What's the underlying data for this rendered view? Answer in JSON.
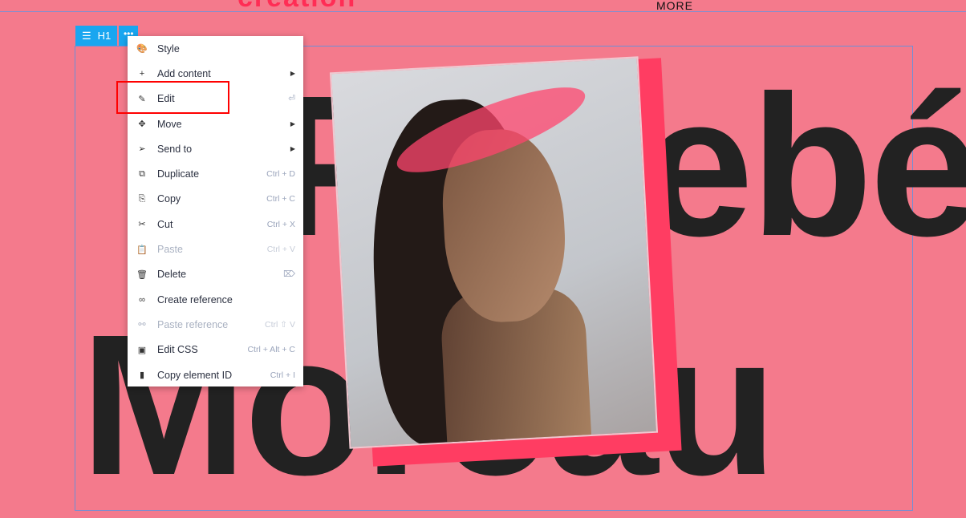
{
  "page": {
    "brand": "creation",
    "more": "MORE",
    "heading_line1": "Phoebé",
    "heading_line2": "Moreau",
    "bg_color": "#f47a8c"
  },
  "toolbar": {
    "tag": "H1",
    "icon": "heading-icon",
    "more_icon": "more-icon",
    "color": "#19a6f0"
  },
  "menu": {
    "items": [
      {
        "label": "Style",
        "icon": "palette-icon",
        "ic": "🎨",
        "shortcut": "",
        "submenu": false,
        "disabled": false
      },
      {
        "label": "Add content",
        "icon": "plus-icon",
        "ic": "+",
        "shortcut": "",
        "submenu": true,
        "disabled": false
      },
      {
        "label": "Edit",
        "icon": "pencil-icon",
        "ic": "✎",
        "shortcut": "⏎",
        "submenu": false,
        "disabled": false
      },
      {
        "label": "Move",
        "icon": "move-icon",
        "ic": "✥",
        "shortcut": "",
        "submenu": true,
        "disabled": false
      },
      {
        "label": "Send to",
        "icon": "send-icon",
        "ic": "➢",
        "shortcut": "",
        "submenu": true,
        "disabled": false
      },
      {
        "label": "Duplicate",
        "icon": "duplicate-icon",
        "ic": "⧉",
        "shortcut": "Ctrl + D",
        "submenu": false,
        "disabled": false
      },
      {
        "label": "Copy",
        "icon": "copy-icon",
        "ic": "⎘",
        "shortcut": "Ctrl + C",
        "submenu": false,
        "disabled": false
      },
      {
        "label": "Cut",
        "icon": "scissors-icon",
        "ic": "✂",
        "shortcut": "Ctrl + X",
        "submenu": false,
        "disabled": false
      },
      {
        "label": "Paste",
        "icon": "paste-icon",
        "ic": "📋",
        "shortcut": "Ctrl + V",
        "submenu": false,
        "disabled": true
      },
      {
        "label": "Delete",
        "icon": "trash-icon",
        "ic": "🗑",
        "shortcut": "⌦",
        "submenu": false,
        "disabled": false
      },
      {
        "label": "Create reference",
        "icon": "link-icon",
        "ic": "∞",
        "shortcut": "",
        "submenu": false,
        "disabled": false
      },
      {
        "label": "Paste reference",
        "icon": "paste-reference-icon",
        "ic": "⚯",
        "shortcut": "Ctrl ⇧ V",
        "submenu": false,
        "disabled": true
      },
      {
        "label": "Edit CSS",
        "icon": "css-icon",
        "ic": "▣",
        "shortcut": "Ctrl + Alt + C",
        "submenu": false,
        "disabled": false
      },
      {
        "label": "Copy element ID",
        "icon": "file-icon",
        "ic": "▮",
        "shortcut": "Ctrl + I",
        "submenu": false,
        "disabled": false
      }
    ]
  },
  "highlight_color": "#ff0000"
}
